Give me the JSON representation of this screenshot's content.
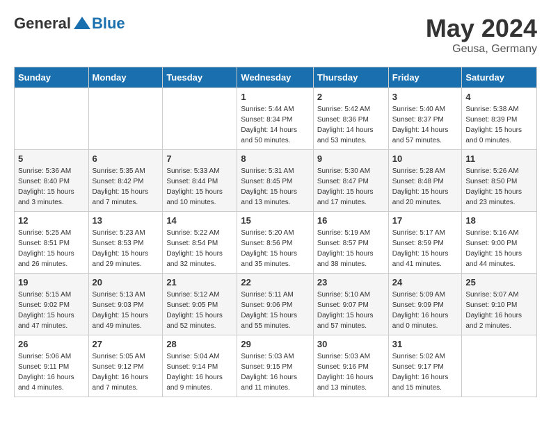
{
  "header": {
    "logo_general": "General",
    "logo_blue": "Blue",
    "title": "May 2024",
    "location": "Geusa, Germany"
  },
  "days_of_week": [
    "Sunday",
    "Monday",
    "Tuesday",
    "Wednesday",
    "Thursday",
    "Friday",
    "Saturday"
  ],
  "weeks": [
    [
      {
        "day": "",
        "sunrise": "",
        "sunset": "",
        "daylight": ""
      },
      {
        "day": "",
        "sunrise": "",
        "sunset": "",
        "daylight": ""
      },
      {
        "day": "",
        "sunrise": "",
        "sunset": "",
        "daylight": ""
      },
      {
        "day": "1",
        "sunrise": "Sunrise: 5:44 AM",
        "sunset": "Sunset: 8:34 PM",
        "daylight": "Daylight: 14 hours and 50 minutes."
      },
      {
        "day": "2",
        "sunrise": "Sunrise: 5:42 AM",
        "sunset": "Sunset: 8:36 PM",
        "daylight": "Daylight: 14 hours and 53 minutes."
      },
      {
        "day": "3",
        "sunrise": "Sunrise: 5:40 AM",
        "sunset": "Sunset: 8:37 PM",
        "daylight": "Daylight: 14 hours and 57 minutes."
      },
      {
        "day": "4",
        "sunrise": "Sunrise: 5:38 AM",
        "sunset": "Sunset: 8:39 PM",
        "daylight": "Daylight: 15 hours and 0 minutes."
      }
    ],
    [
      {
        "day": "5",
        "sunrise": "Sunrise: 5:36 AM",
        "sunset": "Sunset: 8:40 PM",
        "daylight": "Daylight: 15 hours and 3 minutes."
      },
      {
        "day": "6",
        "sunrise": "Sunrise: 5:35 AM",
        "sunset": "Sunset: 8:42 PM",
        "daylight": "Daylight: 15 hours and 7 minutes."
      },
      {
        "day": "7",
        "sunrise": "Sunrise: 5:33 AM",
        "sunset": "Sunset: 8:44 PM",
        "daylight": "Daylight: 15 hours and 10 minutes."
      },
      {
        "day": "8",
        "sunrise": "Sunrise: 5:31 AM",
        "sunset": "Sunset: 8:45 PM",
        "daylight": "Daylight: 15 hours and 13 minutes."
      },
      {
        "day": "9",
        "sunrise": "Sunrise: 5:30 AM",
        "sunset": "Sunset: 8:47 PM",
        "daylight": "Daylight: 15 hours and 17 minutes."
      },
      {
        "day": "10",
        "sunrise": "Sunrise: 5:28 AM",
        "sunset": "Sunset: 8:48 PM",
        "daylight": "Daylight: 15 hours and 20 minutes."
      },
      {
        "day": "11",
        "sunrise": "Sunrise: 5:26 AM",
        "sunset": "Sunset: 8:50 PM",
        "daylight": "Daylight: 15 hours and 23 minutes."
      }
    ],
    [
      {
        "day": "12",
        "sunrise": "Sunrise: 5:25 AM",
        "sunset": "Sunset: 8:51 PM",
        "daylight": "Daylight: 15 hours and 26 minutes."
      },
      {
        "day": "13",
        "sunrise": "Sunrise: 5:23 AM",
        "sunset": "Sunset: 8:53 PM",
        "daylight": "Daylight: 15 hours and 29 minutes."
      },
      {
        "day": "14",
        "sunrise": "Sunrise: 5:22 AM",
        "sunset": "Sunset: 8:54 PM",
        "daylight": "Daylight: 15 hours and 32 minutes."
      },
      {
        "day": "15",
        "sunrise": "Sunrise: 5:20 AM",
        "sunset": "Sunset: 8:56 PM",
        "daylight": "Daylight: 15 hours and 35 minutes."
      },
      {
        "day": "16",
        "sunrise": "Sunrise: 5:19 AM",
        "sunset": "Sunset: 8:57 PM",
        "daylight": "Daylight: 15 hours and 38 minutes."
      },
      {
        "day": "17",
        "sunrise": "Sunrise: 5:17 AM",
        "sunset": "Sunset: 8:59 PM",
        "daylight": "Daylight: 15 hours and 41 minutes."
      },
      {
        "day": "18",
        "sunrise": "Sunrise: 5:16 AM",
        "sunset": "Sunset: 9:00 PM",
        "daylight": "Daylight: 15 hours and 44 minutes."
      }
    ],
    [
      {
        "day": "19",
        "sunrise": "Sunrise: 5:15 AM",
        "sunset": "Sunset: 9:02 PM",
        "daylight": "Daylight: 15 hours and 47 minutes."
      },
      {
        "day": "20",
        "sunrise": "Sunrise: 5:13 AM",
        "sunset": "Sunset: 9:03 PM",
        "daylight": "Daylight: 15 hours and 49 minutes."
      },
      {
        "day": "21",
        "sunrise": "Sunrise: 5:12 AM",
        "sunset": "Sunset: 9:05 PM",
        "daylight": "Daylight: 15 hours and 52 minutes."
      },
      {
        "day": "22",
        "sunrise": "Sunrise: 5:11 AM",
        "sunset": "Sunset: 9:06 PM",
        "daylight": "Daylight: 15 hours and 55 minutes."
      },
      {
        "day": "23",
        "sunrise": "Sunrise: 5:10 AM",
        "sunset": "Sunset: 9:07 PM",
        "daylight": "Daylight: 15 hours and 57 minutes."
      },
      {
        "day": "24",
        "sunrise": "Sunrise: 5:09 AM",
        "sunset": "Sunset: 9:09 PM",
        "daylight": "Daylight: 16 hours and 0 minutes."
      },
      {
        "day": "25",
        "sunrise": "Sunrise: 5:07 AM",
        "sunset": "Sunset: 9:10 PM",
        "daylight": "Daylight: 16 hours and 2 minutes."
      }
    ],
    [
      {
        "day": "26",
        "sunrise": "Sunrise: 5:06 AM",
        "sunset": "Sunset: 9:11 PM",
        "daylight": "Daylight: 16 hours and 4 minutes."
      },
      {
        "day": "27",
        "sunrise": "Sunrise: 5:05 AM",
        "sunset": "Sunset: 9:12 PM",
        "daylight": "Daylight: 16 hours and 7 minutes."
      },
      {
        "day": "28",
        "sunrise": "Sunrise: 5:04 AM",
        "sunset": "Sunset: 9:14 PM",
        "daylight": "Daylight: 16 hours and 9 minutes."
      },
      {
        "day": "29",
        "sunrise": "Sunrise: 5:03 AM",
        "sunset": "Sunset: 9:15 PM",
        "daylight": "Daylight: 16 hours and 11 minutes."
      },
      {
        "day": "30",
        "sunrise": "Sunrise: 5:03 AM",
        "sunset": "Sunset: 9:16 PM",
        "daylight": "Daylight: 16 hours and 13 minutes."
      },
      {
        "day": "31",
        "sunrise": "Sunrise: 5:02 AM",
        "sunset": "Sunset: 9:17 PM",
        "daylight": "Daylight: 16 hours and 15 minutes."
      },
      {
        "day": "",
        "sunrise": "",
        "sunset": "",
        "daylight": ""
      }
    ]
  ]
}
